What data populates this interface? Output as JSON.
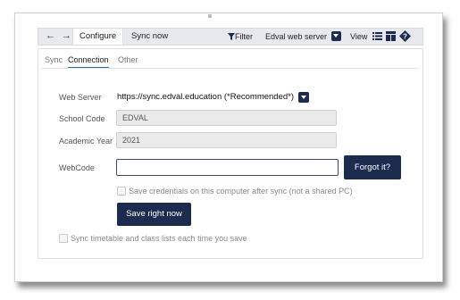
{
  "toolbar": {
    "nav_arrows": "←  →",
    "tabs": [
      {
        "label": "Configure",
        "active": true
      },
      {
        "label": "Sync now",
        "active": false
      }
    ],
    "filter_label": "Filter",
    "school_selector": "Edval web server",
    "view_label": "View"
  },
  "subtabs": [
    {
      "label": "Sync",
      "active": false
    },
    {
      "label": "Connection",
      "active": true
    },
    {
      "label": "Other",
      "active": false
    }
  ],
  "form": {
    "web_server_label": "Web Server",
    "web_server_value": "https://sync.edval.education (*Recommended*)",
    "school_code_label": "School Code",
    "school_code_value": "EDVAL",
    "academic_year_label": "Academic Year",
    "academic_year_value": "2021",
    "webcode_label": "WebCode",
    "webcode_value": "",
    "forgot_label": "Forgot it?",
    "save_credentials_label": "Save credentials on this computer after sync (not a shared PC)",
    "save_credentials_checked": false,
    "save_button_label": "Save right now",
    "sync_each_save_label": "Sync timetable and class lists each time you save",
    "sync_each_save_checked": false
  },
  "icons": {
    "filter": "filter-icon",
    "school_dropdown": "chevron-down-icon",
    "list_view": "list-view-icon",
    "column_view": "column-view-icon",
    "help": "help-icon"
  },
  "colors": {
    "accent": "#1d2b4f",
    "active_tab_underline": "#2b6fb5",
    "toolbar_bg": "#e7e9ee"
  }
}
